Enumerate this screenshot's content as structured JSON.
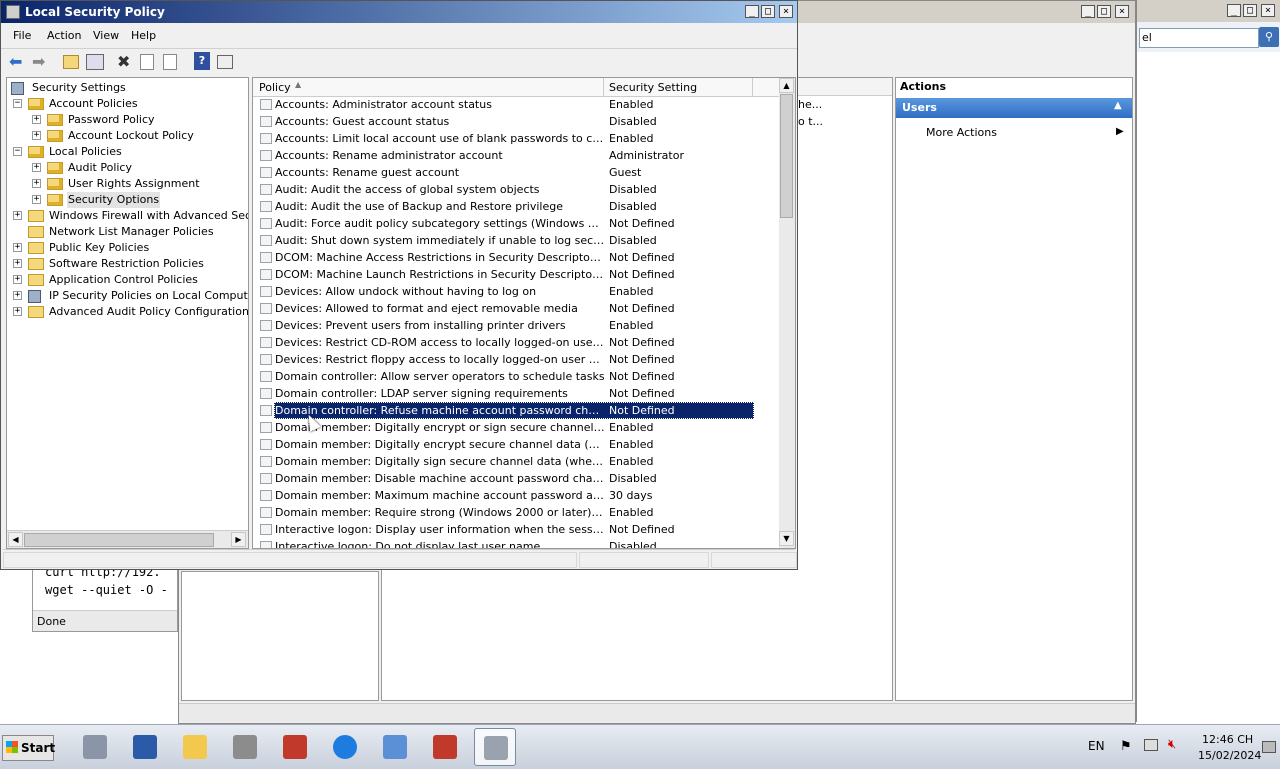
{
  "lsp": {
    "title": "Local Security Policy",
    "menu": [
      "File",
      "Action",
      "View",
      "Help"
    ],
    "tree": [
      {
        "label": "Security Settings",
        "level": 0,
        "expander": "",
        "icon": "security-settings-icon"
      },
      {
        "label": "Account Policies",
        "level": 1,
        "expander": "−",
        "icon": "folder-lock-icon"
      },
      {
        "label": "Password Policy",
        "level": 2,
        "expander": "+",
        "icon": "folder-lock-icon"
      },
      {
        "label": "Account Lockout Policy",
        "level": 2,
        "expander": "+",
        "icon": "folder-lock-icon"
      },
      {
        "label": "Local Policies",
        "level": 1,
        "expander": "−",
        "icon": "folder-lock-icon"
      },
      {
        "label": "Audit Policy",
        "level": 2,
        "expander": "+",
        "icon": "folder-lock-icon"
      },
      {
        "label": "User Rights Assignment",
        "level": 2,
        "expander": "+",
        "icon": "folder-lock-icon"
      },
      {
        "label": "Security Options",
        "level": 2,
        "expander": "+",
        "icon": "folder-lock-icon",
        "selected": true
      },
      {
        "label": "Windows Firewall with Advanced Security",
        "level": 1,
        "expander": "+",
        "icon": "folder-icon"
      },
      {
        "label": "Network List Manager Policies",
        "level": 1,
        "expander": "",
        "icon": "folder-icon"
      },
      {
        "label": "Public Key Policies",
        "level": 1,
        "expander": "+",
        "icon": "folder-icon"
      },
      {
        "label": "Software Restriction Policies",
        "level": 1,
        "expander": "+",
        "icon": "folder-icon"
      },
      {
        "label": "Application Control Policies",
        "level": 1,
        "expander": "+",
        "icon": "folder-icon"
      },
      {
        "label": "IP Security Policies on Local Computer",
        "level": 1,
        "expander": "+",
        "icon": "ip-security-icon"
      },
      {
        "label": "Advanced Audit Policy Configuration",
        "level": 1,
        "expander": "+",
        "icon": "folder-icon"
      }
    ],
    "columns": {
      "policy": "Policy",
      "setting": "Security Setting"
    },
    "rows": [
      {
        "policy": "Accounts: Administrator account status",
        "setting": "Enabled"
      },
      {
        "policy": "Accounts: Guest account status",
        "setting": "Disabled"
      },
      {
        "policy": "Accounts: Limit local account use of blank passwords to console l...",
        "setting": "Enabled"
      },
      {
        "policy": "Accounts: Rename administrator account",
        "setting": "Administrator"
      },
      {
        "policy": "Accounts: Rename guest account",
        "setting": "Guest"
      },
      {
        "policy": "Audit: Audit the access of global system objects",
        "setting": "Disabled"
      },
      {
        "policy": "Audit: Audit the use of Backup and Restore privilege",
        "setting": "Disabled"
      },
      {
        "policy": "Audit: Force audit policy subcategory settings (Windows Vista or l...",
        "setting": "Not Defined"
      },
      {
        "policy": "Audit: Shut down system immediately if unable to log security audits",
        "setting": "Disabled"
      },
      {
        "policy": "DCOM: Machine Access Restrictions in Security Descriptor Definiti...",
        "setting": "Not Defined"
      },
      {
        "policy": "DCOM: Machine Launch Restrictions in Security Descriptor Definiti...",
        "setting": "Not Defined"
      },
      {
        "policy": "Devices: Allow undock without having to log on",
        "setting": "Enabled"
      },
      {
        "policy": "Devices: Allowed to format and eject removable media",
        "setting": "Not Defined"
      },
      {
        "policy": "Devices: Prevent users from installing printer drivers",
        "setting": "Enabled"
      },
      {
        "policy": "Devices: Restrict CD-ROM access to locally logged-on user only",
        "setting": "Not Defined"
      },
      {
        "policy": "Devices: Restrict floppy access to locally logged-on user only",
        "setting": "Not Defined"
      },
      {
        "policy": "Domain controller: Allow server operators to schedule tasks",
        "setting": "Not Defined"
      },
      {
        "policy": "Domain controller: LDAP server signing requirements",
        "setting": "Not Defined"
      },
      {
        "policy": "Domain controller: Refuse machine account password changes",
        "setting": "Not Defined",
        "selected": true
      },
      {
        "policy": "Domain member: Digitally encrypt or sign secure channel data (al...",
        "setting": "Enabled"
      },
      {
        "policy": "Domain member: Digitally encrypt secure channel data (when pos...",
        "setting": "Enabled"
      },
      {
        "policy": "Domain member: Digitally sign secure channel data (when possible)",
        "setting": "Enabled"
      },
      {
        "policy": "Domain member: Disable machine account password changes",
        "setting": "Disabled"
      },
      {
        "policy": "Domain member: Maximum machine account password age",
        "setting": "30 days"
      },
      {
        "policy": "Domain member: Require strong (Windows 2000 or later) session ...",
        "setting": "Enabled"
      },
      {
        "policy": "Interactive logon: Display user information when the session is lo...",
        "setting": "Not Defined"
      },
      {
        "policy": "Interactive logon: Do not display last user name",
        "setting": "Disabled"
      }
    ]
  },
  "mmc": {
    "actions_header": "Actions",
    "actions_section": "Users",
    "more_actions": "More Actions",
    "search_value": "el",
    "bg_list_text": [
      "he...",
      "o t..."
    ]
  },
  "ie": {
    "code_lines": [
      "curl http://192.",
      "wget --quiet -O -"
    ],
    "status": "Done"
  },
  "taskbar": {
    "start": "Start",
    "lang": "EN",
    "time": "12:46 CH",
    "date": "15/02/2024",
    "apps": [
      "server-manager-icon",
      "powershell-icon",
      "explorer-icon",
      "tools-icon",
      "toolbox-icon",
      "ie-icon",
      "control-panel-icon",
      "toolbox-icon",
      "security-policy-icon"
    ]
  },
  "colors": {
    "selection": "#0a246a",
    "actions_bar": "#3f7fcf",
    "title_active": "#0a246a"
  }
}
